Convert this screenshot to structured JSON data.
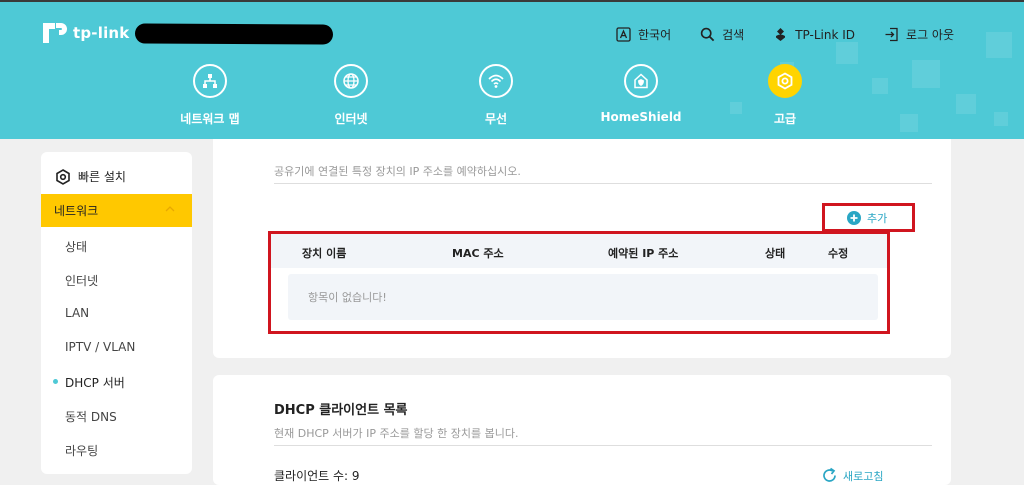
{
  "header": {
    "brand": "tp-link",
    "links": [
      {
        "label": "한국어",
        "icon": "language-icon"
      },
      {
        "label": "검색",
        "icon": "search-icon"
      },
      {
        "label": "TP-Link ID",
        "icon": "tplink-id-icon"
      },
      {
        "label": "로그 아웃",
        "icon": "logout-icon"
      }
    ],
    "nav": [
      {
        "label": "네트워크 맵",
        "icon": "network-map-icon",
        "active": false
      },
      {
        "label": "인터넷",
        "icon": "globe-icon",
        "active": false
      },
      {
        "label": "무선",
        "icon": "wifi-icon",
        "active": false
      },
      {
        "label": "HomeShield",
        "icon": "homeshield-icon",
        "active": false
      },
      {
        "label": "고급",
        "icon": "gear-icon",
        "active": true
      }
    ],
    "accent_color": "#4ec9d6",
    "active_color": "#ffd400"
  },
  "sidebar": {
    "quick_setup": "빠른 설치",
    "active_section": "네트워크",
    "items": [
      "상태",
      "인터넷",
      "LAN",
      "IPTV / VLAN",
      "DHCP 서버",
      "동적 DNS",
      "라우팅"
    ],
    "current": "DHCP 서버"
  },
  "reservation": {
    "description": "공유기에 연결된 특정 장치의 IP 주소를 예약하십시오.",
    "add_label": "추가",
    "columns": [
      "장치 이름",
      "MAC 주소",
      "예약된 IP 주소",
      "상태",
      "수정"
    ],
    "empty_text": "항목이 없습니다!"
  },
  "client_list": {
    "title": "DHCP 클라이언트 목록",
    "description": "현재 DHCP 서버가 IP 주소를 할당 한 장치를 봅니다.",
    "count_text": "클라이언트 수: 9",
    "refresh_label": "새로고침"
  },
  "highlight_color": "#d0151f"
}
